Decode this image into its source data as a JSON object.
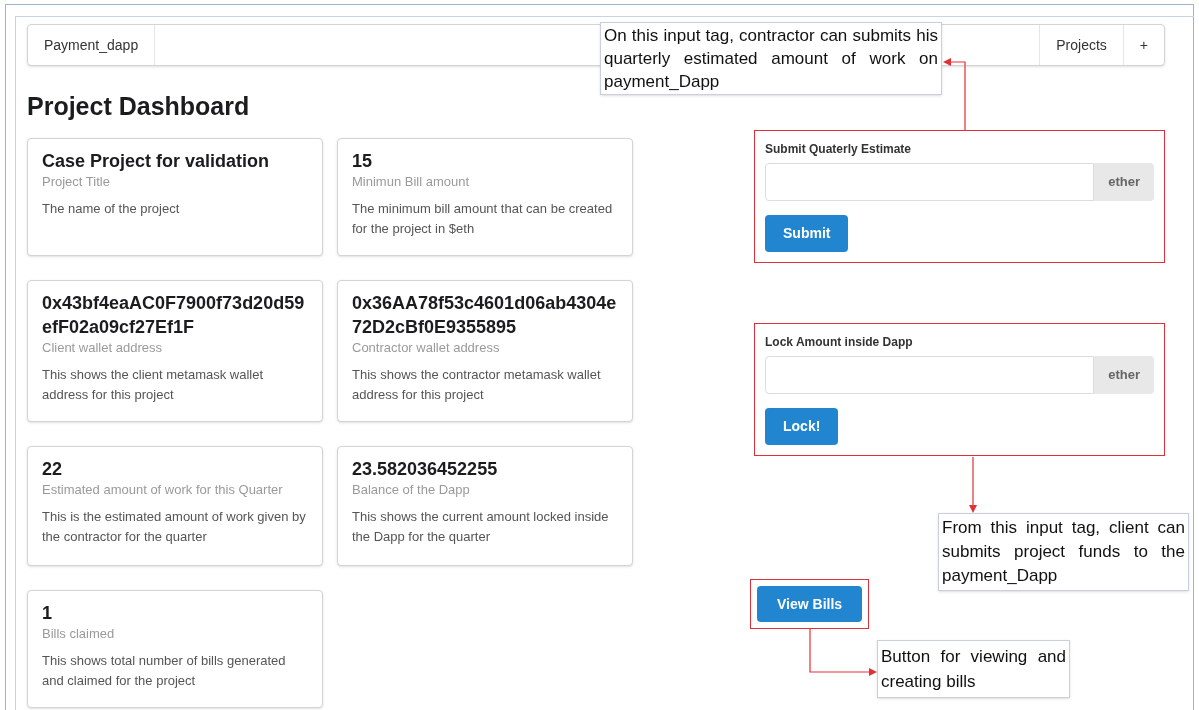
{
  "navbar": {
    "brand": "Payment_dapp",
    "items": [
      {
        "label": "Projects"
      },
      {
        "label": "+"
      }
    ]
  },
  "heading": "Project Dashboard",
  "cards": [
    {
      "value": "Case Project for validation",
      "label": "Project Title",
      "description": "The name of the project"
    },
    {
      "value": "15",
      "label": "Minimun Bill amount",
      "description": "The minimum bill amount that can be created for the project in $eth"
    },
    {
      "value": "0x43bf4eaAC0F7900f73d20d59efF02a09cf27Ef1F",
      "label": "Client wallet address",
      "description": "This shows the client metamask wallet address for this project"
    },
    {
      "value": "0x36AA78f53c4601d06ab4304e72D2cBf0E9355895",
      "label": "Contractor wallet address",
      "description": "This shows the contractor metamask wallet address for this project"
    },
    {
      "value": "22",
      "label": "Estimated amount of work for this Quarter",
      "description": "This is the estimated amount of work given by the contractor for the quarter"
    },
    {
      "value": "23.582036452255",
      "label": "Balance of the Dapp",
      "description": "This shows the current amount locked inside the Dapp for the quarter"
    },
    {
      "value": "1",
      "label": "Bills claimed",
      "description": "This shows total number of bills generated and claimed for the project"
    }
  ],
  "forms": [
    {
      "label": "Submit Quaterly Estimate",
      "unit": "ether",
      "button": "Submit"
    },
    {
      "label": "Lock Amount inside Dapp",
      "unit": "ether",
      "button": "Lock!"
    }
  ],
  "view_bills_button": "View Bills",
  "annotations": [
    {
      "text": "On this input tag, contractor can submits his quarterly estimated amount of work on payment_Dapp"
    },
    {
      "text": "From this input tag, client can submits project funds to the payment_Dapp"
    },
    {
      "text": "Button for viewing and creating bills"
    }
  ]
}
